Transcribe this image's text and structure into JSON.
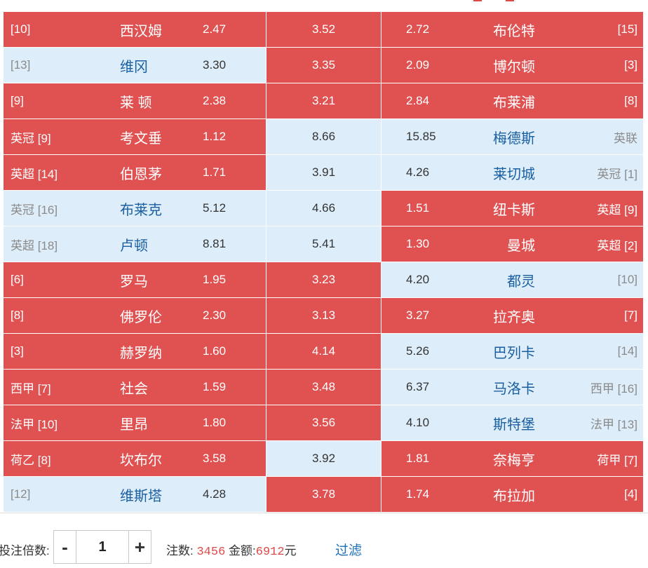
{
  "matches": [
    {
      "home_rank": "[10]",
      "home_team": "西汉姆",
      "home_odd": "2.47",
      "draw_odd": "3.52",
      "away_odd": "2.72",
      "away_team": "布伦特",
      "away_rank": "[15]",
      "sel": [
        "red",
        "red",
        "red"
      ]
    },
    {
      "home_rank": "[13]",
      "home_team": "维冈",
      "home_odd": "3.30",
      "draw_odd": "3.35",
      "away_odd": "2.09",
      "away_team": "博尔顿",
      "away_rank": "[3]",
      "sel": [
        "blue",
        "red",
        "red"
      ]
    },
    {
      "home_rank": "[9]",
      "home_team": "莱 顿",
      "home_odd": "2.38",
      "draw_odd": "3.21",
      "away_odd": "2.84",
      "away_team": "布莱浦",
      "away_rank": "[8]",
      "sel": [
        "red",
        "red",
        "red"
      ]
    },
    {
      "home_rank": "英冠 [9]",
      "home_team": "考文垂",
      "home_odd": "1.12",
      "draw_odd": "8.66",
      "away_odd": "15.85",
      "away_team": "梅德斯",
      "away_rank": "英联",
      "sel": [
        "red",
        "blue",
        "blue"
      ]
    },
    {
      "home_rank": "英超 [14]",
      "home_team": "伯恩茅",
      "home_odd": "1.71",
      "draw_odd": "3.91",
      "away_odd": "4.26",
      "away_team": "莱切城",
      "away_rank": "英冠 [1]",
      "sel": [
        "red",
        "blue",
        "blue"
      ]
    },
    {
      "home_rank": "英冠 [16]",
      "home_team": "布莱克",
      "home_odd": "5.12",
      "draw_odd": "4.66",
      "away_odd": "1.51",
      "away_team": "纽卡斯",
      "away_rank": "英超 [9]",
      "sel": [
        "blue",
        "blue",
        "red"
      ]
    },
    {
      "home_rank": "英超 [18]",
      "home_team": "卢顿",
      "home_odd": "8.81",
      "draw_odd": "5.41",
      "away_odd": "1.30",
      "away_team": "曼城",
      "away_rank": "英超 [2]",
      "sel": [
        "blue",
        "blue",
        "red"
      ]
    },
    {
      "home_rank": "[6]",
      "home_team": "罗马",
      "home_odd": "1.95",
      "draw_odd": "3.23",
      "away_odd": "4.20",
      "away_team": "都灵",
      "away_rank": "[10]",
      "sel": [
        "red",
        "red",
        "blue"
      ]
    },
    {
      "home_rank": "[8]",
      "home_team": "佛罗伦",
      "home_odd": "2.30",
      "draw_odd": "3.13",
      "away_odd": "3.27",
      "away_team": "拉齐奥",
      "away_rank": "[7]",
      "sel": [
        "red",
        "red",
        "red"
      ]
    },
    {
      "home_rank": "[3]",
      "home_team": "赫罗纳",
      "home_odd": "1.60",
      "draw_odd": "4.14",
      "away_odd": "5.26",
      "away_team": "巴列卡",
      "away_rank": "[14]",
      "sel": [
        "red",
        "red",
        "blue"
      ]
    },
    {
      "home_rank": "西甲 [7]",
      "home_team": "社会",
      "home_odd": "1.59",
      "draw_odd": "3.48",
      "away_odd": "6.37",
      "away_team": "马洛卡",
      "away_rank": "西甲 [16]",
      "sel": [
        "red",
        "red",
        "blue"
      ]
    },
    {
      "home_rank": "法甲 [10]",
      "home_team": "里昂",
      "home_odd": "1.80",
      "draw_odd": "3.56",
      "away_odd": "4.10",
      "away_team": "斯特堡",
      "away_rank": "法甲 [13]",
      "sel": [
        "red",
        "red",
        "blue"
      ]
    },
    {
      "home_rank": "荷乙 [8]",
      "home_team": "坎布尔",
      "home_odd": "3.58",
      "draw_odd": "3.92",
      "away_odd": "1.81",
      "away_team": "奈梅亨",
      "away_rank": "荷甲 [7]",
      "sel": [
        "red",
        "blue",
        "red"
      ]
    },
    {
      "home_rank": "[12]",
      "home_team": "维斯塔",
      "home_odd": "4.28",
      "draw_odd": "3.78",
      "away_odd": "1.74",
      "away_team": "布拉加",
      "away_rank": "[4]",
      "sel": [
        "blue",
        "red",
        "red"
      ]
    }
  ],
  "footer": {
    "multiplier_label": "投注倍数:",
    "minus_label": "-",
    "multiplier_value": "1",
    "plus_label": "+",
    "count_label": "注数:",
    "count_value": "3456",
    "amount_label": "金额:",
    "amount_value": "6912",
    "currency": "元",
    "filter_label": "过滤"
  },
  "colors": {
    "selected": "#e05252",
    "unselected": "#ddeefa",
    "team_link": "#1a5fa0",
    "highlight_number": "#e04848",
    "filter_link": "#1a6fb8"
  }
}
